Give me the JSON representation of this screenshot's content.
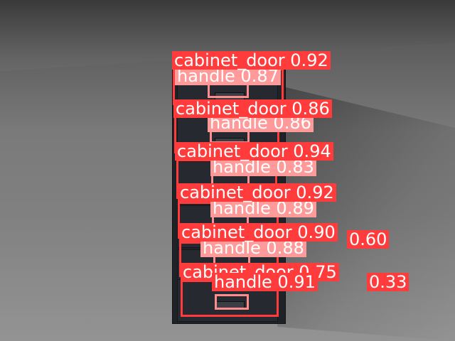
{
  "colors": {
    "cabinet_door_box": "#ff3b3b",
    "handle_box": "#ff9a9a",
    "label_text": "#ffffff"
  },
  "detections": {
    "d1": {
      "label": "cabinet_door 0.92"
    },
    "h1": {
      "label": "handle 0.87"
    },
    "d2": {
      "label": "cabinet_door 0.86"
    },
    "h2": {
      "label": "handle 0.86"
    },
    "d3": {
      "label": "cabinet_door 0.94"
    },
    "h3": {
      "label": "handle 0.83"
    },
    "d4": {
      "label": "cabinet_door 0.92"
    },
    "h4": {
      "label": "handle 0.89"
    },
    "d5": {
      "label": "cabinet_door 0.90"
    },
    "h5": {
      "label": "handle 0.88"
    },
    "x1": {
      "label": "0.60"
    },
    "d6": {
      "label": "cabinet_door 0.75"
    },
    "h6": {
      "label": "handle 0.91"
    },
    "x2": {
      "label": "0.33"
    }
  }
}
